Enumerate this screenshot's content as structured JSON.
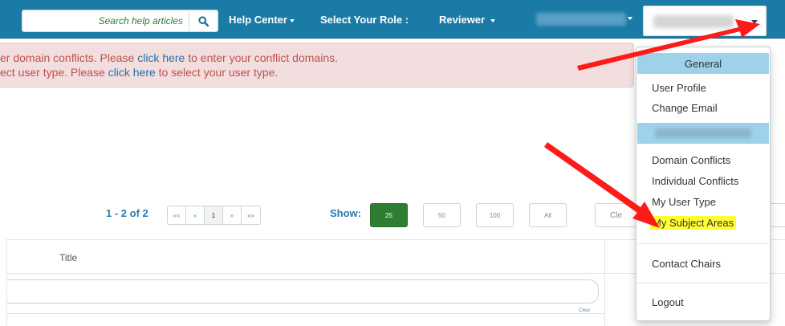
{
  "nav": {
    "search_placeholder": "Search help articles",
    "help_center": "Help Center",
    "select_role_label": "Select Your Role :",
    "role_value": "Reviewer"
  },
  "alert": {
    "line1_pre": "er domain conflicts. Please ",
    "line1_link": "click here",
    "line1_post": " to enter your conflict domains.",
    "line2_pre": "ect user type. Please ",
    "line2_link": "click here",
    "line2_post": " to select your user type."
  },
  "pagination": {
    "range": "1 - 2 of 2",
    "first": "««",
    "prev": "«",
    "current_page": "1",
    "next": "»",
    "last": "»»",
    "show_label": "Show:",
    "sizes": [
      "25",
      "50",
      "100",
      "All"
    ],
    "clear": "Cle"
  },
  "table": {
    "col_title": "Title",
    "filter_clear": "Clear"
  },
  "dropdown": {
    "general_header": "General",
    "items_general": [
      "User Profile",
      "Change Email"
    ],
    "items_conference": [
      "Domain Conflicts",
      "Individual Conflicts",
      "My User Type",
      "My Subject Areas"
    ],
    "contact_chairs": "Contact Chairs",
    "logout": "Logout"
  },
  "colors": {
    "nav_bg": "#1a7ba6",
    "alert_bg": "#f2dede",
    "alert_text": "#c0504d",
    "active_page_size": "#2e7d32",
    "highlight": "#ffff33",
    "arrow": "#ff1a1a"
  }
}
